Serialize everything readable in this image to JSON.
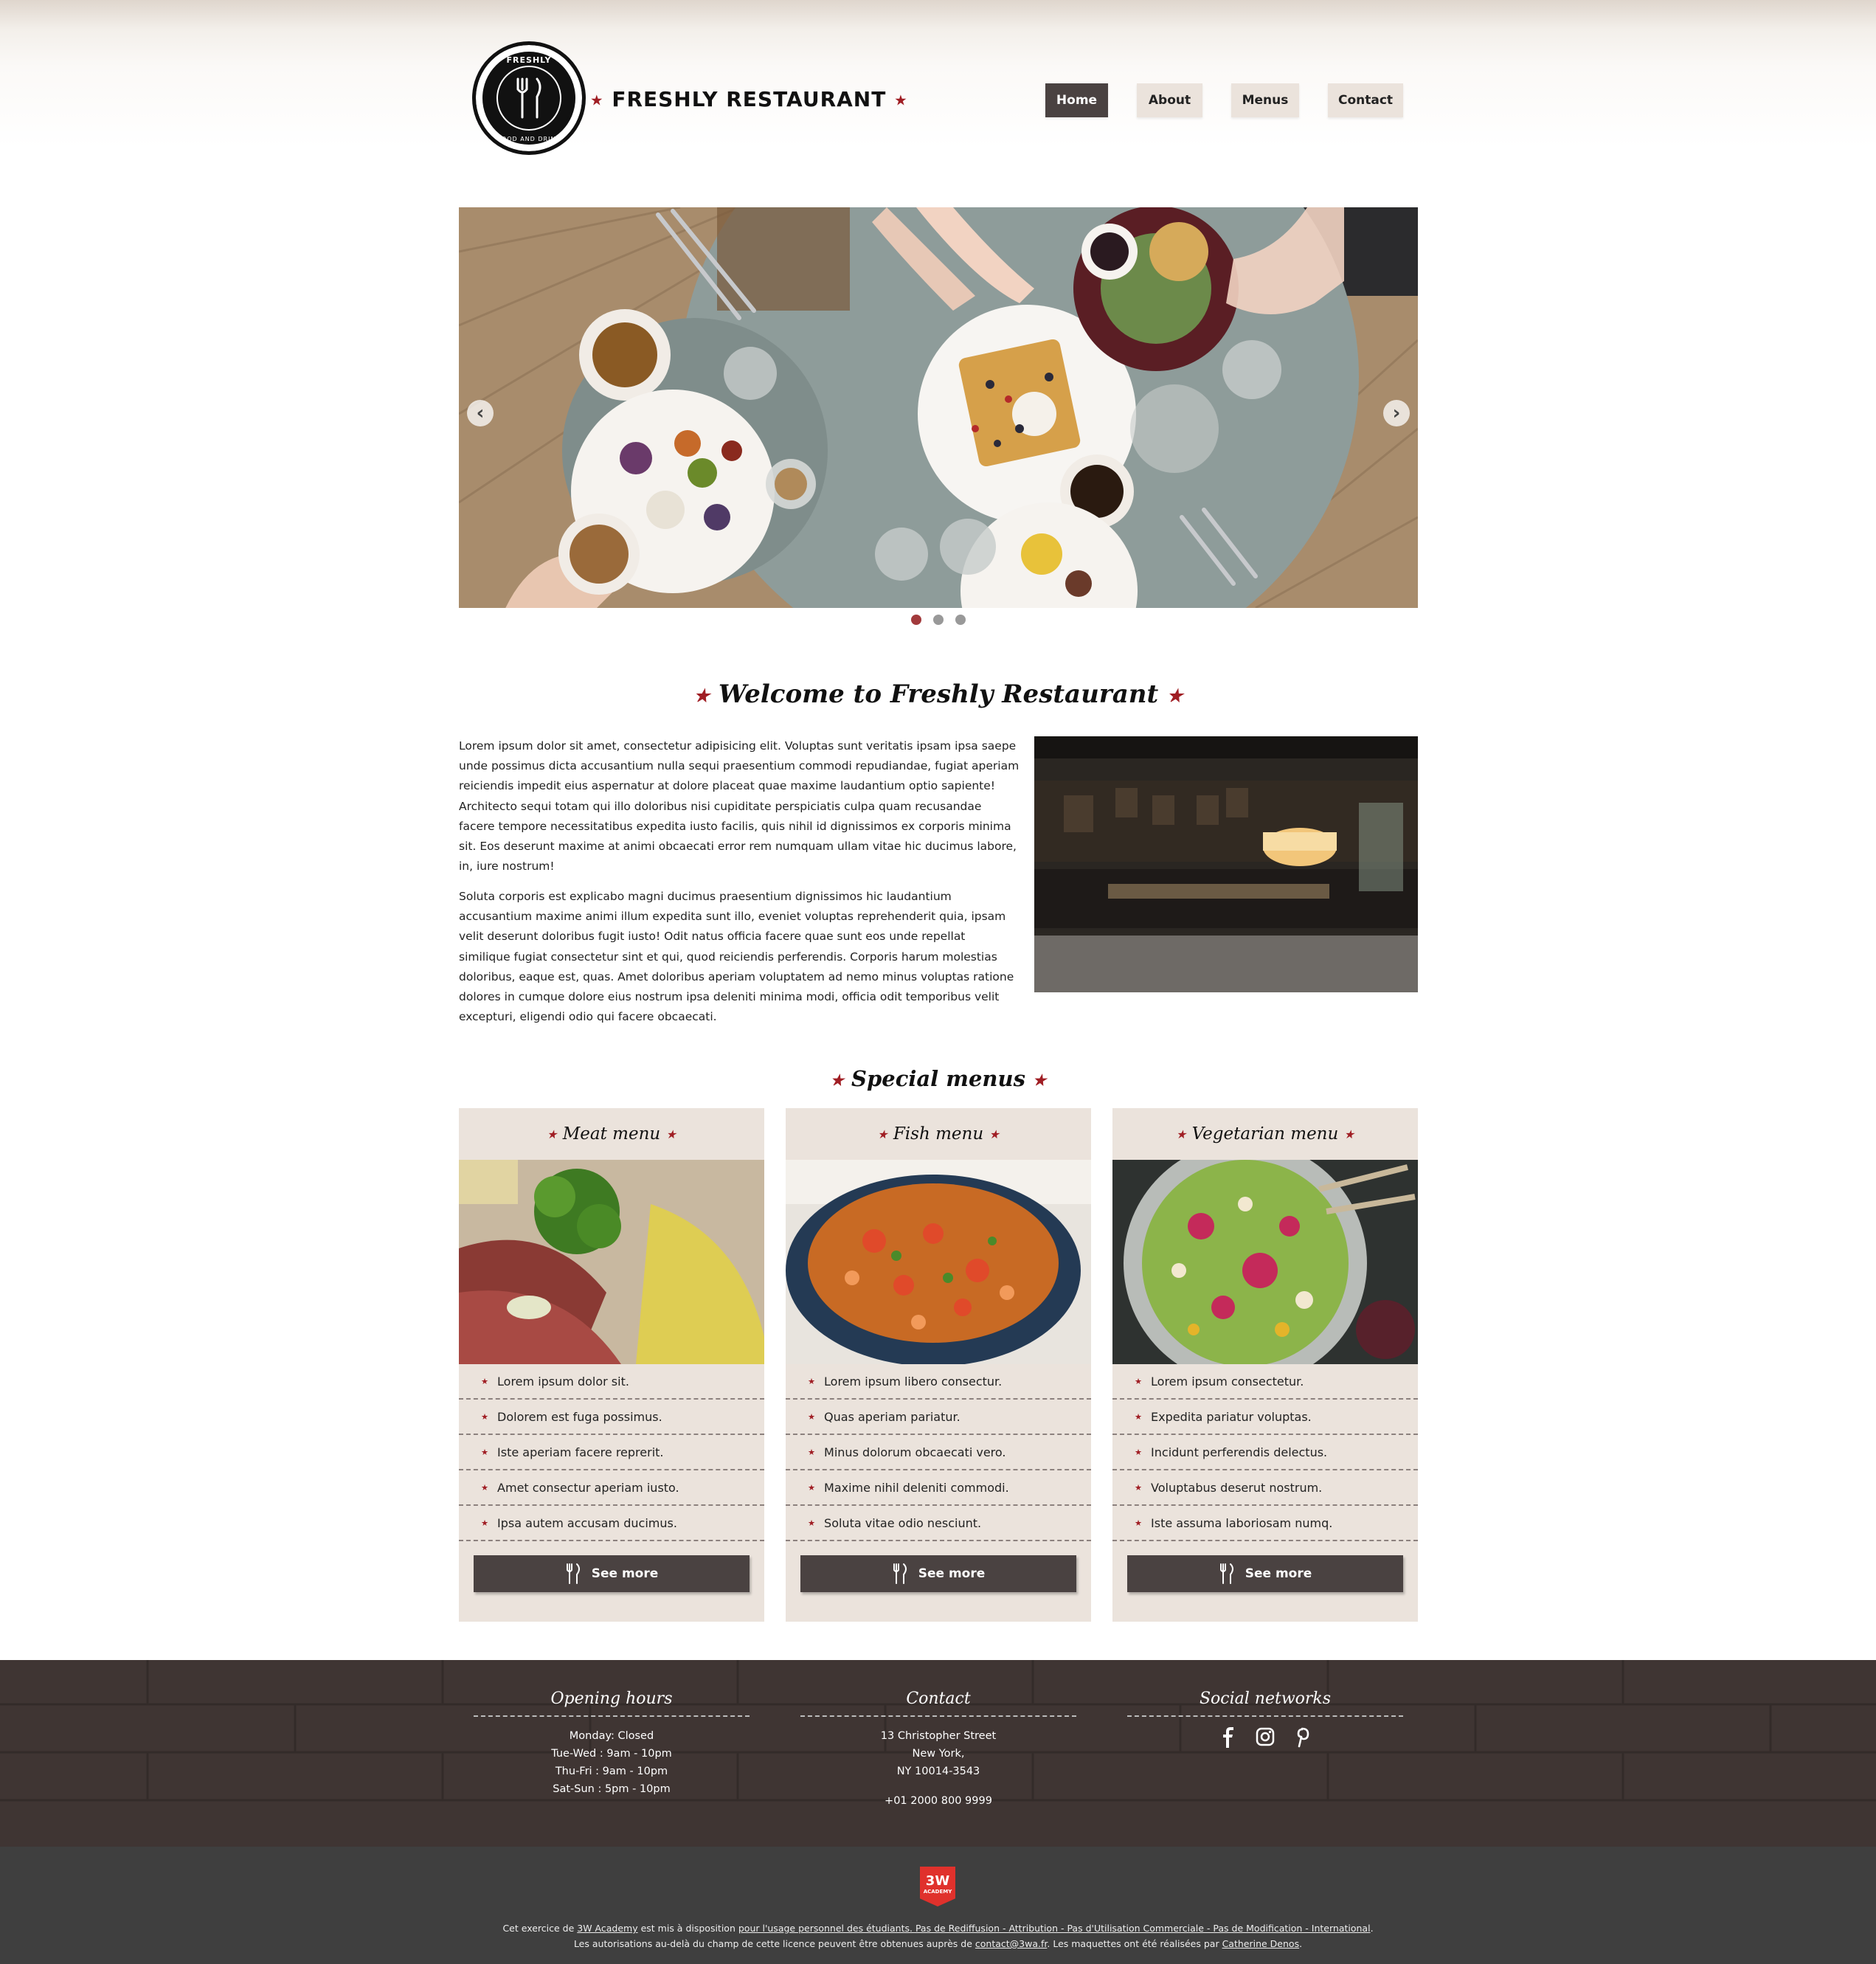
{
  "header": {
    "logo_top": "FRESHLY",
    "logo_bottom": "FOOD AND DRINK",
    "brand": "FRESHLY RESTAURANT",
    "nav": [
      {
        "label": "Home",
        "active": true
      },
      {
        "label": "About",
        "active": false
      },
      {
        "label": "Menus",
        "active": false
      },
      {
        "label": "Contact",
        "active": false
      }
    ]
  },
  "slider": {
    "prev_icon": "chevron-left-icon",
    "next_icon": "chevron-right-icon",
    "slides": 3,
    "active_slide": 1
  },
  "welcome": {
    "title": "Welcome to Freshly Restaurant",
    "paragraph1": "Lorem ipsum dolor sit amet, consectetur adipisicing elit. Voluptas sunt veritatis ipsam ipsa saepe unde possimus dicta accusantium nulla sequi praesentium commodi repudiandae, fugiat aperiam reiciendis impedit eius aspernatur at dolore placeat quae maxime laudantium optio sapiente! Architecto sequi totam qui illo doloribus nisi cupiditate perspiciatis culpa quam recusandae facere tempore necessitatibus expedita iusto facilis, quis nihil id dignissimos ex corporis minima sit. Eos deserunt maxime at animi obcaecati error rem numquam ullam vitae hic ducimus labore, in, iure nostrum!",
    "paragraph2": "Soluta corporis est explicabo magni ducimus praesentium dignissimos hic laudantium accusantium maxime animi illum expedita sunt illo, eveniet voluptas reprehenderit quia, ipsam velit deserunt doloribus fugit iusto! Odit natus officia facere quae sunt eos unde repellat similique fugiat consectetur sint et qui, quod reiciendis perferendis. Corporis harum molestias doloribus, eaque est, quas. Amet doloribus aperiam voluptatem ad nemo minus voluptas ratione dolores in cumque dolore eius nostrum ipsa deleniti minima modi, officia odit temporibus velit excepturi, eligendi odio qui facere obcaecati."
  },
  "menus": {
    "title": "Special menus",
    "cards": [
      {
        "title": "Meat menu",
        "items": [
          "Lorem ipsum dolor sit.",
          "Dolorem est fuga possimus.",
          "Iste aperiam facere reprerit.",
          "Amet consectur aperiam iusto.",
          "Ipsa autem accusam ducimus."
        ],
        "button": "See more"
      },
      {
        "title": "Fish menu",
        "items": [
          "Lorem ipsum libero consectur.",
          "Quas aperiam pariatur.",
          "Minus dolorum obcaecati vero.",
          "Maxime nihil deleniti commodi.",
          "Soluta vitae odio nesciunt."
        ],
        "button": "See more"
      },
      {
        "title": "Vegetarian menu",
        "items": [
          "Lorem ipsum consectetur.",
          "Expedita pariatur voluptas.",
          "Incidunt perferendis delectus.",
          "Voluptabus deserut nostrum.",
          "Iste assuma laboriosam numq."
        ],
        "button": "See more"
      }
    ]
  },
  "footer": {
    "hours": {
      "title": "Opening hours",
      "lines": [
        "Monday: Closed",
        "Tue-Wed : 9am - 10pm",
        "Thu-Fri : 9am - 10pm",
        "Sat-Sun : 5pm - 10pm"
      ]
    },
    "contact": {
      "title": "Contact",
      "lines": [
        "13 Christopher Street",
        "New York,",
        "NY 10014-3543"
      ],
      "phone": "+01 2000 800 9999"
    },
    "social": {
      "title": "Social networks",
      "icons": [
        "facebook-icon",
        "instagram-icon",
        "pinterest-icon"
      ]
    }
  },
  "legal": {
    "badge": "3W",
    "badge_sub": "ACADEMY",
    "l1_a": "Cet exercice de ",
    "l1_link1": "3W Academy",
    "l1_b": " est mis à disposition ",
    "l1_link2": "pour l'usage personnel des étudiants. Pas de Rediffusion - Attribution - Pas d'Utilisation Commerciale - Pas de Modification - International",
    "l1_c": ".",
    "l2_a": "Les autorisations au-delà du champ de cette licence peuvent être obtenues auprès de ",
    "l2_link1": "contact@3wa.fr",
    "l2_b": ". Les maquettes ont été réalisées par ",
    "l2_link2": "Catherine Denos",
    "l2_c": "."
  },
  "colors": {
    "accent": "#a01e24",
    "dark": "#4a4241",
    "card_bg": "#ebe3dc"
  }
}
